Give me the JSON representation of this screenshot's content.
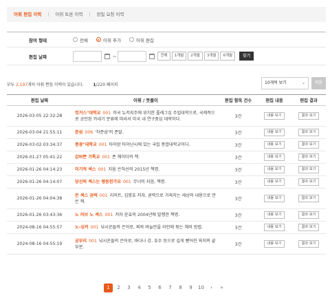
{
  "tabs": [
    {
      "label": "어휘 편집 이력",
      "active": true
    },
    {
      "label": "어휘 토론 이력",
      "active": false
    },
    {
      "label": "정밀 요청 이력",
      "active": false
    }
  ],
  "filter": {
    "type_label": "참여 형태",
    "type_options": [
      {
        "label": "전체",
        "selected": false
      },
      {
        "label": "어휘 추가",
        "selected": true
      },
      {
        "label": "어휘 편집",
        "selected": false
      }
    ],
    "date_label": "편집 날짜",
    "date_separator": "~",
    "periods": [
      "전체",
      "1개월",
      "2개월",
      "3개월",
      "6개월"
    ],
    "search_label": "찾기"
  },
  "summary": {
    "prefix": "모두 ",
    "total": "2,197",
    "suffix": "개의 어휘 편집 이력이 있습니다.",
    "current_page": "1",
    "total_pages": "/220 페이지"
  },
  "view_select": {
    "value": "10개씩 보기"
  },
  "apply_label": "적용",
  "table": {
    "headers": [
      "편집 날짜",
      "어휘 / 뜻풀이",
      "편집 항목 건수",
      "편집 내용",
      "편집 결과"
    ],
    "view_content_label": "내용 보기",
    "view_result_label": "결과 보기",
    "rows": [
      {
        "date": "2026-03-05 22:32:28",
        "word": "컷거스\"대학교",
        "sup": "",
        "no": "001",
        "def": "미국 뉴저지주에 위치한 플래그십 주립대학으로, 국제적으로 공인된 카네기 분류에 따라서 미국 내 연구중심 대학이다.",
        "count": "3건"
      },
      {
        "date": "2026-03-04 21:55:11",
        "word": "춘삼",
        "sup": "",
        "no": "006",
        "def": "'차준삼'의 준말.",
        "count": "3건"
      },
      {
        "date": "2026-03-02 03:34:37",
        "word": "풍광\"대학교",
        "sup": "",
        "no": "001",
        "def": "타이완 타이난시에 있는 국립 종합대학교이다.",
        "count": "3건"
      },
      {
        "date": "2026-01-27 05:41:22",
        "word": "갑바쁜 가톡교",
        "sup": "",
        "no": "001",
        "def": "존 헤이더의 책.",
        "count": "3건"
      },
      {
        "date": "2026-01-26 04:14:23",
        "word": "이기적 섹스",
        "sup": "",
        "no": "001",
        "def": "지음 은하선의 2015년 책명.",
        "count": "3건"
      },
      {
        "date": "2026-01-26 04:14:07",
        "word": "당신의 섹스는 평등한가요",
        "sup": "",
        "no": "001",
        "def": "무너미 지음, 책명.",
        "count": "3건"
      },
      {
        "date": "2026-01-26 04:04:38",
        "word": "돈 섹스 권력",
        "sup": "",
        "no": "001",
        "def": "리저트, 김영호 저자, 권력으로 가져지는 세상의 내용으로 만든 책.",
        "count": "3건"
      },
      {
        "date": "2026-01-26 03:43:36",
        "word": "노 러브 노 섹스",
        "sup": "",
        "no": "001",
        "def": "저자 윤효의 2004년에 발행한 책명.",
        "count": "3건"
      },
      {
        "date": "2024-08-16 04:55:57",
        "word": "노-싱커",
        "sup": "",
        "no": "001",
        "def": "낚시꾼들의 은어로, 찌와 바늘만을 라인에 묶는 채비 방법.",
        "count": "3건"
      },
      {
        "date": "2024-08-16 04:55:19",
        "word": "궁부리",
        "sup": "",
        "no": "001",
        "def": "낚시꾼들의 은어로, 바다나 강, 호수 등으로 길게 뻗어진 육지의 끝 부분.",
        "count": "3건"
      }
    ]
  },
  "pagination": {
    "pages": [
      "1",
      "2",
      "3",
      "4",
      "5",
      "6",
      "7",
      "8",
      "9",
      "10"
    ],
    "current": "1",
    "next": "›",
    "last": "»"
  },
  "accent_color": "#e8591a"
}
